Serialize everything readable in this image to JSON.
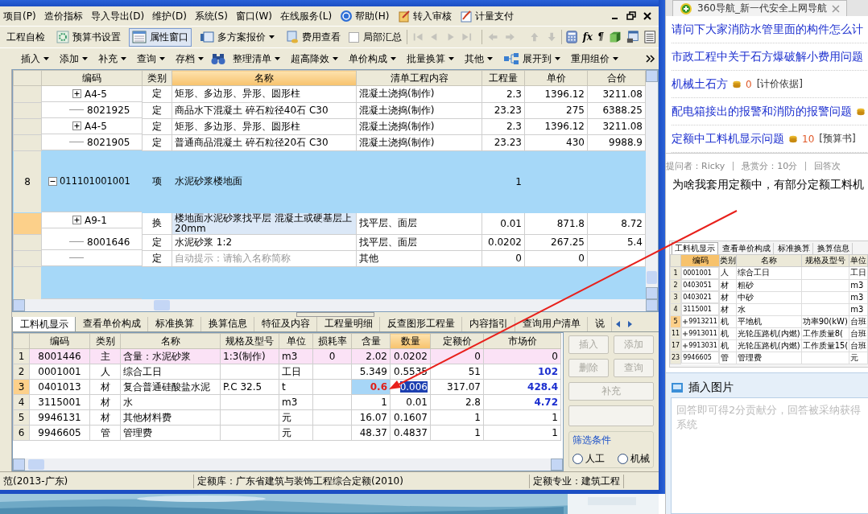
{
  "app": {
    "menu": [
      {
        "label": "项目(P)",
        "kind": "text"
      },
      {
        "label": "造价指标",
        "kind": "text"
      },
      {
        "label": "导入导出(D)",
        "kind": "text"
      },
      {
        "label": "维护(D)",
        "kind": "text"
      },
      {
        "label": "系统(S)",
        "kind": "text"
      },
      {
        "label": "窗口(W)",
        "kind": "text"
      },
      {
        "label": "在线服务(L)",
        "kind": "text"
      },
      {
        "label": "帮助(H)",
        "kind": "help"
      },
      {
        "label": "转入审核",
        "kind": "review"
      },
      {
        "label": "计量支付",
        "kind": "pay"
      }
    ],
    "toolbar": [
      {
        "label": "工程自检",
        "kind": "text",
        "pressed": false
      },
      {
        "label": "预算书设置",
        "kind": "gear",
        "pressed": false
      },
      {
        "label": "属性窗口",
        "kind": "window",
        "pressed": true
      },
      {
        "label": "多方案报价",
        "kind": "plan",
        "pressed": false
      },
      {
        "label": "费用查看",
        "kind": "cost",
        "pressed": false
      },
      {
        "label": "局部汇总",
        "kind": "check",
        "checked": false
      }
    ],
    "tools": [
      {
        "kind": "calc"
      },
      {
        "kind": "glyph",
        "label": "fx"
      },
      {
        "kind": "glyph",
        "label": "¶"
      },
      {
        "kind": "cube"
      },
      {
        "kind": "report"
      },
      {
        "kind": "list"
      }
    ],
    "edit_bar": [
      {
        "label": "插入",
        "kind": "menu"
      },
      {
        "label": "添加",
        "kind": "menu"
      },
      {
        "label": "补充",
        "kind": "menu"
      },
      {
        "label": "查询",
        "kind": "menu"
      },
      {
        "label": "存档",
        "kind": "menu"
      },
      {
        "kind": "search"
      },
      {
        "label": "整理清单",
        "kind": "menu"
      },
      {
        "label": "超高降效",
        "kind": "menu"
      },
      {
        "label": "单价构成",
        "kind": "menu"
      },
      {
        "label": "批量换算",
        "kind": "menu"
      },
      {
        "label": "其他",
        "kind": "menu"
      },
      {
        "label": "展开到",
        "kind": "tree"
      },
      {
        "label": "重用组价",
        "kind": "menu"
      }
    ],
    "bill_table": {
      "columns": [
        {
          "label": "编码",
          "highlighted": false
        },
        {
          "label": "类别",
          "highlighted": false
        },
        {
          "label": "名称",
          "highlighted": true
        },
        {
          "label": "清单工程内容",
          "highlighted": false
        },
        {
          "label": "工程量",
          "highlighted": false
        },
        {
          "label": "单价",
          "highlighted": false
        },
        {
          "label": "合价",
          "highlighted": false
        }
      ],
      "rows": [
        {
          "kind": "quota",
          "expanded": false,
          "code": "A4-5",
          "type": "定",
          "name": "矩形、多边形、异形、圆形柱",
          "content": "混凝土浇捣(制作)",
          "quantity": "2.3",
          "price": "1396.12",
          "total": "3211.08",
          "selected": false
        },
        {
          "kind": "quota",
          "code": "8021925",
          "type": "定",
          "name": "商品水下混凝土 碎石粒径40石 C30",
          "content": "混凝土浇捣(制作)",
          "quantity": "23.23",
          "price": "275",
          "total": "6388.25",
          "selected": false
        },
        {
          "kind": "quota",
          "expanded": false,
          "code": "A4-5",
          "type": "定",
          "name": "矩形、多边形、异形、圆形柱",
          "content": "混凝土浇捣(制作)",
          "quantity": "2.3",
          "price": "1396.12",
          "total": "3211.08",
          "selected": false
        },
        {
          "kind": "quota",
          "code": "8021905",
          "type": "定",
          "name": "普通商品混凝土 碎石粒径20石 C30",
          "content": "混凝土浇捣(制作)",
          "quantity": "23.23",
          "price": "430",
          "total": "9988.9",
          "selected": false
        },
        {
          "kind": "bill",
          "number": "8",
          "expanded": true,
          "code": "011101001001",
          "type": "项",
          "name": "水泥砂浆楼地面",
          "quantity": "1",
          "selected": false
        },
        {
          "kind": "quota",
          "expanded": false,
          "code": "A9-1",
          "type": "换",
          "name": "楼地面水泥砂浆找平层 混凝土或硬基层上 20mm",
          "content": "找平层、面层",
          "quantity": "0.01",
          "price": "871.8",
          "total": "8.72",
          "selected": true
        },
        {
          "kind": "quota",
          "code": "8001646",
          "type": "定",
          "name": "水泥砂浆 1:2",
          "content": "找平层、面层",
          "quantity": "0.0202",
          "price": "267.25",
          "total": "5.4",
          "selected": false
        },
        {
          "kind": "tip",
          "type": "定",
          "name": "自动提示：请输入名称简称",
          "content": "其他",
          "quantity": "0",
          "price": "0",
          "selected": false
        },
        {
          "kind": "bill",
          "selected": false
        }
      ]
    },
    "tabs": [
      {
        "label": "工料机显示",
        "selected": true
      },
      {
        "label": "查看单价构成",
        "selected": false
      },
      {
        "label": "标准换算",
        "selected": false
      },
      {
        "label": "换算信息",
        "selected": false
      },
      {
        "label": "特征及内容",
        "selected": false
      },
      {
        "label": "工程量明细",
        "selected": false
      },
      {
        "label": "反查图形工程量",
        "selected": false
      },
      {
        "label": "内容指引",
        "selected": false
      },
      {
        "label": "查询用户清单",
        "selected": false
      },
      {
        "label": "说",
        "selected": false
      }
    ],
    "resource_table": {
      "columns": [
        {
          "label": "编码",
          "highlighted": false
        },
        {
          "label": "类别",
          "highlighted": false
        },
        {
          "label": "名称",
          "highlighted": false
        },
        {
          "label": "规格及型号",
          "highlighted": false
        },
        {
          "label": "单位",
          "highlighted": false
        },
        {
          "label": "损耗率",
          "highlighted": false
        },
        {
          "label": "含量",
          "highlighted": false
        },
        {
          "label": "数量",
          "highlighted": true
        },
        {
          "label": "定额价",
          "highlighted": false
        },
        {
          "label": "市场价",
          "highlighted": false
        }
      ],
      "rows": [
        {
          "number": "1",
          "kind": "main",
          "code": "8001446",
          "type": "主",
          "name": "含量：水泥砂浆",
          "spec": "1:3(制作)",
          "unit": "m3",
          "loss": "0",
          "content": "2.02",
          "qty": "0.0202",
          "quota_price": "0",
          "market_price": "0",
          "adjusted": false,
          "selected": false
        },
        {
          "number": "2",
          "kind": "normal",
          "code": "0001001",
          "type": "人",
          "name": "综合工日",
          "unit": "工日",
          "content": "5.349",
          "qty": "0.5535",
          "quota_price": "51",
          "market_price": "102",
          "adjusted": true,
          "selected": false
        },
        {
          "number": "3",
          "kind": "normal",
          "code": "0401013",
          "type": "材",
          "name": "复合普通硅酸盐水泥",
          "spec": "P.C 32.5",
          "unit": "t",
          "content": "0.6",
          "qty": "0.006",
          "quota_price": "317.07",
          "market_price": "428.4",
          "adjusted": true,
          "selected": true
        },
        {
          "number": "4",
          "kind": "normal",
          "code": "3115001",
          "type": "材",
          "name": "水",
          "unit": "m3",
          "content": "1",
          "qty": "0.01",
          "quota_price": "2.8",
          "market_price": "4.72",
          "adjusted": true,
          "selected": false
        },
        {
          "number": "5",
          "kind": "normal",
          "code": "9946131",
          "type": "材",
          "name": "其他材料费",
          "unit": "元",
          "content": "16.07",
          "qty": "0.1607",
          "quota_price": "1",
          "market_price": "1",
          "adjusted": false,
          "selected": false
        },
        {
          "number": "6",
          "kind": "normal",
          "code": "9946605",
          "type": "管",
          "name": "管理费",
          "unit": "元",
          "content": "48.37",
          "qty": "0.4837",
          "quota_price": "1",
          "market_price": "1",
          "adjusted": false,
          "selected": false
        }
      ]
    },
    "side_buttons": [
      {
        "label": "插入",
        "disabled": true
      },
      {
        "label": "添加",
        "disabled": true
      },
      {
        "label": "删除",
        "disabled": true
      },
      {
        "label": "查询",
        "disabled": true
      },
      {
        "label": "补充",
        "disabled": true
      }
    ],
    "filter": {
      "title": "筛选条件",
      "options": [
        {
          "label": "人工",
          "selected": false
        },
        {
          "label": "机械",
          "selected": false
        }
      ]
    },
    "status_bar": [
      "范(2013-广东)",
      "定额库：广东省建筑与装饰工程综合定额(2010)",
      "定额专业：建筑工程"
    ]
  },
  "browser": {
    "tab": {
      "title": "360导航_新一代安全上网导航"
    },
    "questions": [
      {
        "title": "请问下大家消防水管里面的构件怎么计",
        "kind": "plain"
      },
      {
        "title": "市政工程中关于石方爆破解小费用问题",
        "kind": "plain"
      },
      {
        "title": "机械土石方",
        "kind": "reward",
        "reward": "0",
        "category": "[计价依据]"
      },
      {
        "title": "配电箱接出的报警和消防的报警问题",
        "kind": "reward"
      },
      {
        "title": "定额中工料机显示问题",
        "kind": "reward",
        "reward": "10",
        "category": "[预算书]"
      }
    ],
    "meta": [
      "提问者：Ricky",
      "悬赏分：10分",
      "回答次"
    ],
    "question": "为啥我套用定额中，有部分定额工料机",
    "shot": {
      "tabs": [
        {
          "label": "工料机显示",
          "selected": true
        },
        {
          "label": "查看单价构成",
          "selected": false
        },
        {
          "label": "标准换算",
          "selected": false
        },
        {
          "label": "换算信息",
          "selected": false
        }
      ],
      "columns": [
        "编码",
        "类别",
        "名称",
        "规格及型号",
        "单位"
      ],
      "rows": [
        {
          "number": "1",
          "code": "0001001",
          "type": "人",
          "name": "综合工日",
          "unit": "工日",
          "selected": false
        },
        {
          "number": "2",
          "code": "0403051",
          "type": "材",
          "name": "粗砂",
          "unit": "m3",
          "selected": false
        },
        {
          "number": "3",
          "code": "0403021",
          "type": "材",
          "name": "中砂",
          "unit": "m3",
          "selected": false
        },
        {
          "number": "4",
          "code": "3115001",
          "type": "材",
          "name": "水",
          "unit": "m3",
          "selected": false
        },
        {
          "number": "5",
          "expandable": true,
          "code": "9913211",
          "type": "机",
          "name": "平地机",
          "spec": "功率90(kW)",
          "unit": "台班",
          "selected": true
        },
        {
          "number": "11",
          "expandable": true,
          "code": "9913011",
          "type": "机",
          "name": "光轮压路机(内燃)",
          "spec": "工作质量8(",
          "unit": "台班",
          "selected": false
        },
        {
          "number": "17",
          "expandable": true,
          "code": "9913031",
          "type": "机",
          "name": "光轮压路机(内燃)",
          "spec": "工作质量15(",
          "unit": "台班",
          "selected": false
        },
        {
          "number": "23",
          "code": "9946605",
          "type": "管",
          "name": "管理费",
          "unit": "元",
          "selected": false
        }
      ]
    },
    "answer": {
      "insert_label": "插入图片",
      "placeholder": "回答即可得2分贡献分，回答被采纳获得系统"
    }
  }
}
